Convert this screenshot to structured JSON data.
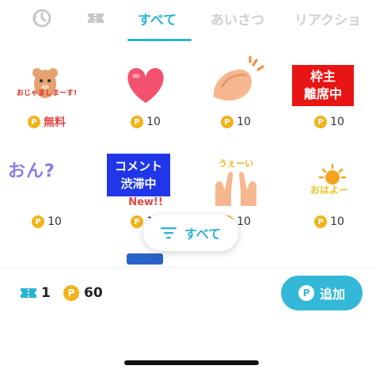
{
  "tabs": {
    "icons": [
      "history-icon",
      "ticket-icon"
    ],
    "labels": [
      "すべて",
      "あいさつ",
      "リアクショ"
    ],
    "active": "すべて"
  },
  "stickers": [
    {
      "name": "sticker-ojama",
      "text": "おじゃましまーす!",
      "price": "無料",
      "free": true
    },
    {
      "name": "sticker-heart",
      "text": "",
      "price": "10",
      "free": false
    },
    {
      "name": "sticker-clap",
      "text": "",
      "price": "10",
      "free": false
    },
    {
      "name": "sticker-waku-rimu",
      "text": "枠主\n離席中",
      "price": "10",
      "free": false
    },
    {
      "name": "sticker-on",
      "text": "おん?",
      "price": "10",
      "free": false
    },
    {
      "name": "sticker-comment-jutai",
      "text": "コメント\n渋滞中",
      "badge": "New!!",
      "price": "10",
      "free": false
    },
    {
      "name": "sticker-uei",
      "text": "うぇーい",
      "price": "10",
      "free": false
    },
    {
      "name": "sticker-ohayo",
      "text": "おはよー",
      "price": "10",
      "free": false
    }
  ],
  "coin_glyph": "P",
  "filter": {
    "label": "すべて"
  },
  "balance": {
    "tickets": "1",
    "coins": "60"
  },
  "add_button": {
    "label": "追加"
  },
  "colors": {
    "accent": "#2bb3d4",
    "coin": "#f2b21a",
    "free": "#e64545"
  }
}
